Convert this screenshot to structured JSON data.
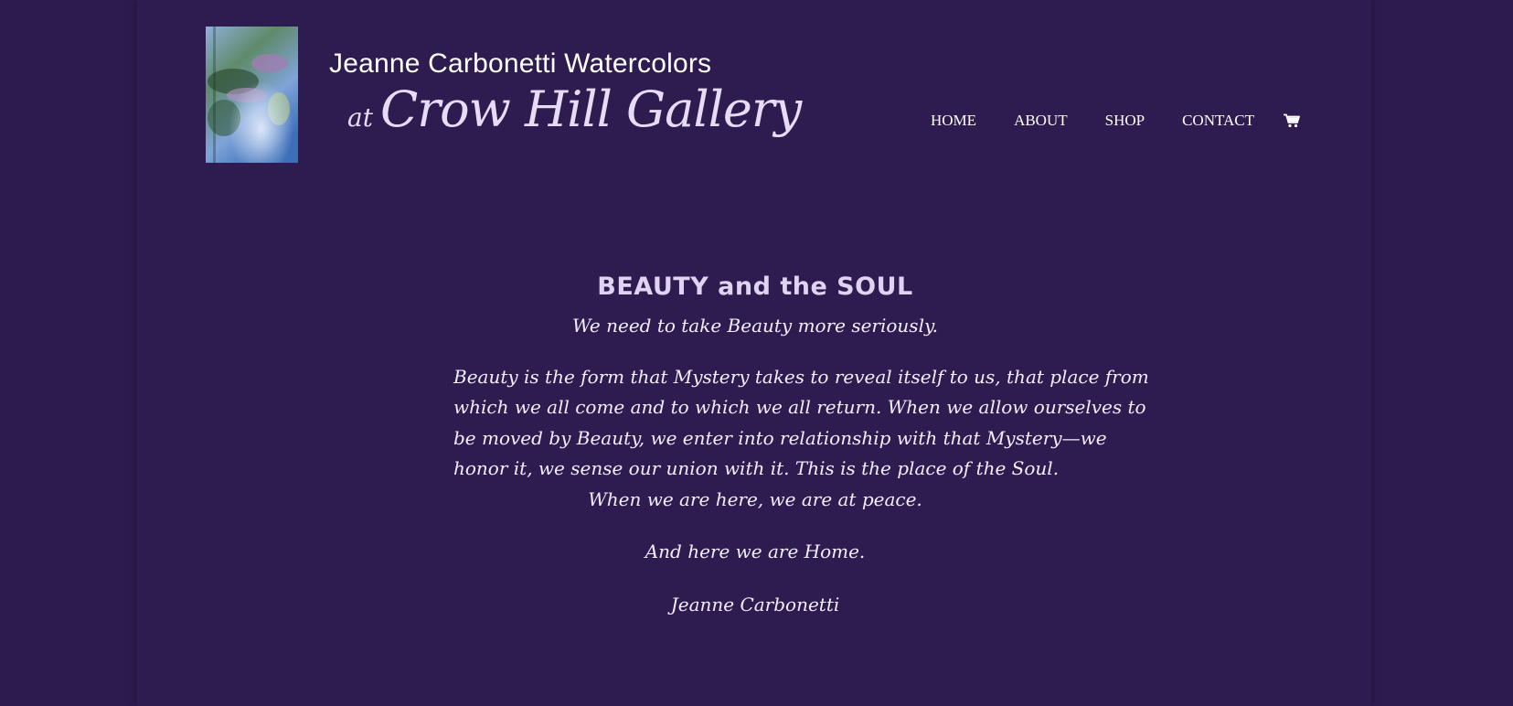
{
  "brand": {
    "line1": "Jeanne Carbonetti Watercolors",
    "at": "at",
    "name": "Crow Hill Gallery"
  },
  "nav": {
    "items": [
      {
        "label": "HOME"
      },
      {
        "label": "ABOUT"
      },
      {
        "label": "SHOP"
      },
      {
        "label": "CONTACT"
      }
    ],
    "cart_icon": "shopping-cart-icon"
  },
  "main": {
    "title": "BEAUTY and the SOUL",
    "subtitle": "We need to take Beauty more seriously.",
    "body_lines": [
      "Beauty is the form that Mystery takes to reveal itself to us, that place from",
      "which we all come and to which we all return. When we allow ourselves to",
      "be moved by Beauty, we enter into relationship with that Mystery—we",
      "honor it, we sense our union with it. This is the place of the Soul.",
      "When we are here, we are at peace."
    ],
    "home_line": "And here we are Home.",
    "signature": "Jeanne Carbonetti"
  },
  "colors": {
    "background": "#2d1b4e",
    "text": "#ffffff",
    "title": "#ded4f2"
  }
}
